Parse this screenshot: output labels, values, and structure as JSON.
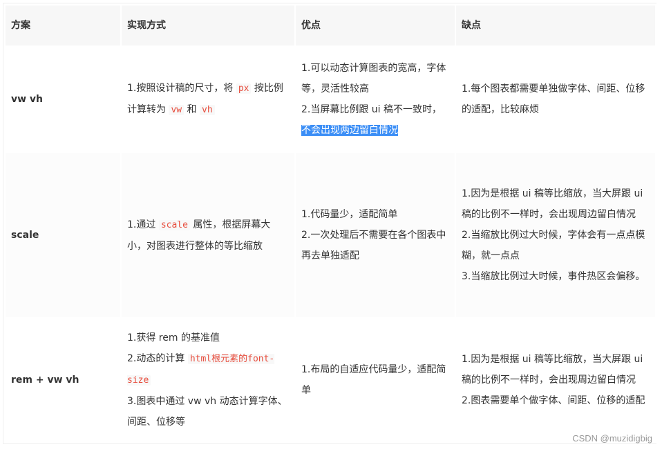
{
  "headers": [
    "方案",
    "实现方式",
    "优点",
    "缺点"
  ],
  "rows": [
    {
      "name": "vw vh",
      "method": {
        "pre": "1.按照设计稿的尺寸，将 ",
        "code1": "px",
        "mid1": " 按比例计算转为 ",
        "code2": "vw",
        "mid2": " 和 ",
        "code3": "vh"
      },
      "pros": {
        "line1": "1.可以动态计算图表的宽高，字体等，灵活性较高",
        "line2_pre": "2.当屏幕比例跟 ui 稿不一致时，",
        "line2_highlight": "不会出现两边留白情况"
      },
      "cons": [
        "1.每个图表都需要单独做字体、间距、位移的适配，比较麻烦"
      ]
    },
    {
      "name": "scale",
      "method": {
        "pre": "1.通过 ",
        "code1": "scale",
        "post": " 属性，根据屏幕大小，对图表进行整体的等比缩放"
      },
      "pros": [
        "1.代码量少，适配简单",
        "2.一次处理后不需要在各个图表中再去单独适配"
      ],
      "cons": [
        "1.因为是根据 ui 稿等比缩放，当大屏跟 ui 稿的比例不一样时，会出现周边留白情况",
        "2.当缩放比例过大时候，字体会有一点点模糊，就一点点",
        "3.当缩放比例过大时候，事件热区会偏移。"
      ]
    },
    {
      "name": "rem + vw vh",
      "method": {
        "line1": "1.获得 rem 的基准值",
        "line2_pre": "2.动态的计算 ",
        "line2_code": "html根元素的font-size",
        "line3": "3.图表中通过 vw vh 动态计算字体、间距、位移等"
      },
      "pros": [
        "1.布局的自适应代码量少，适配简单"
      ],
      "cons": [
        "1.因为是根据 ui 稿等比缩放，当大屏跟 ui 稿的比例不一样时，会出现周边留白情况",
        "2.图表需要单个做字体、间距、位移的适配"
      ]
    }
  ],
  "watermark": "CSDN @muzidigbig"
}
